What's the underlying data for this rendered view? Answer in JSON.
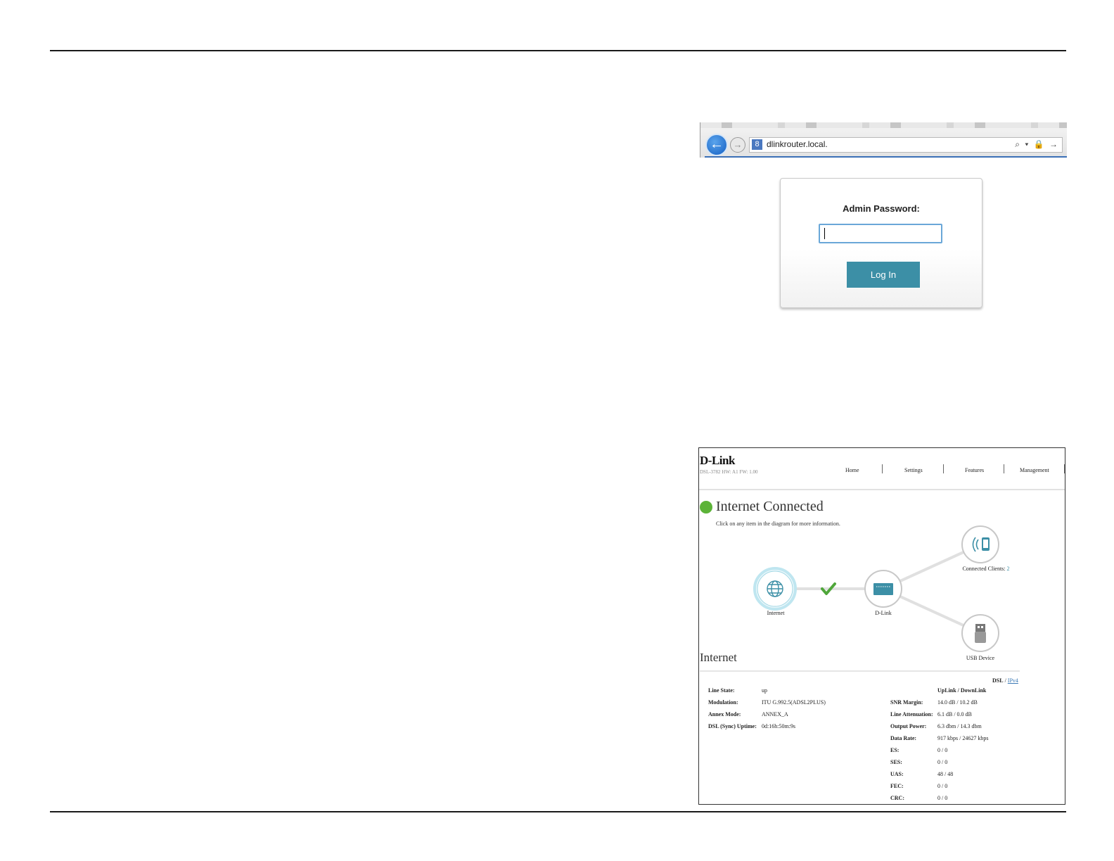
{
  "browser": {
    "url": "dlinkrouter.local.",
    "back_glyph": "←",
    "forward_glyph": "→",
    "site_icon_glyph": "8",
    "tools_glyphs": "⌕ ▾ 🔒 →"
  },
  "login": {
    "label": "Admin Password:",
    "password_value": "",
    "button_label": "Log In"
  },
  "router": {
    "logo": "D-Link",
    "subtitle": "DSL-3782  HW: A1  FW: 1.00",
    "nav": [
      "Home",
      "Settings",
      "Features",
      "Management"
    ],
    "status": {
      "title": "Internet Connected",
      "subtitle": "Click on any item in the diagram for more information.",
      "color": "#5cb338"
    },
    "diagram": {
      "internet_label": "Internet",
      "dlink_label": "D-Link",
      "clients_label": "Connected Clients:",
      "clients_count": "2",
      "usb_label": "USB Device",
      "check_color": "#4fa63a",
      "accent": "#3c8fa6"
    },
    "section_title": "Internet",
    "tabs": {
      "active": "DSL",
      "separator": "/",
      "other": "IPv4"
    },
    "left_stats": [
      {
        "key": "Line State:",
        "value": "up"
      },
      {
        "key": "Modulation:",
        "value": "ITU G.992.5(ADSL2PLUS)"
      },
      {
        "key": "Annex Mode:",
        "value": "ANNEX_A"
      },
      {
        "key": "DSL (Sync) Uptime:",
        "value": "0d:16h:50m:9s"
      }
    ],
    "right_header": "UpLink / DownLink",
    "right_stats": [
      {
        "key": "SNR Margin:",
        "value": "14.0 dB / 10.2 dB"
      },
      {
        "key": "Line Attenuation:",
        "value": "6.1 dB / 0.0 dB"
      },
      {
        "key": "Output Power:",
        "value": "6.3 dbm / 14.3 dbm"
      },
      {
        "key": "Data Rate:",
        "value": "917 kbps / 24627 kbps"
      },
      {
        "key": "ES:",
        "value": "0 / 0"
      },
      {
        "key": "SES:",
        "value": "0 / 0"
      },
      {
        "key": "UAS:",
        "value": "48 / 48"
      },
      {
        "key": "FEC:",
        "value": "0 / 0"
      },
      {
        "key": "CRC:",
        "value": "0 / 0"
      }
    ]
  }
}
